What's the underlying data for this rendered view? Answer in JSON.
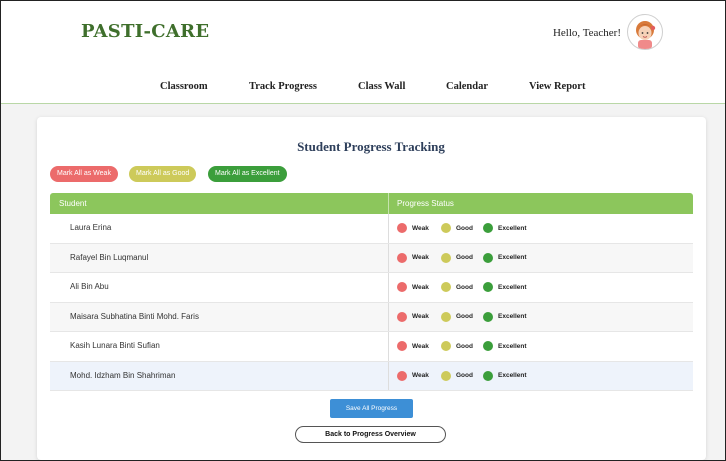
{
  "app": {
    "brand": "PASTI-CARE",
    "greeting": "Hello, Teacher!"
  },
  "nav": [
    {
      "label": "Classroom"
    },
    {
      "label": "Track Progress"
    },
    {
      "label": "Class Wall"
    },
    {
      "label": "Calendar"
    },
    {
      "label": "View Report"
    }
  ],
  "page": {
    "title": "Student Progress Tracking"
  },
  "bulk_actions": {
    "weak": "Mark All as Weak",
    "good": "Mark All as Good",
    "excellent": "Mark All as Excellent"
  },
  "table": {
    "headers": {
      "student": "Student",
      "status": "Progress Status"
    },
    "status_options": {
      "weak": "Weak",
      "good": "Good",
      "excellent": "Excellent"
    },
    "rows": [
      {
        "name": "Laura Erina"
      },
      {
        "name": "Rafayel Bin Luqmanul"
      },
      {
        "name": "Ali Bin Abu"
      },
      {
        "name": "Maisara Subhatina Binti Mohd. Faris"
      },
      {
        "name": "Kasih Lunara Binti Sufian"
      },
      {
        "name": "Mohd. Idzham Bin Shahriman"
      }
    ]
  },
  "actions": {
    "save": "Save All Progress",
    "back": "Back to Progress Overview"
  },
  "colors": {
    "brand": "#3f6f2c",
    "header_green": "#8cc65c",
    "weak": "#ec6b6b",
    "good": "#cdca5a",
    "excellent": "#3b9e3b",
    "save_blue": "#3d8fd6"
  }
}
